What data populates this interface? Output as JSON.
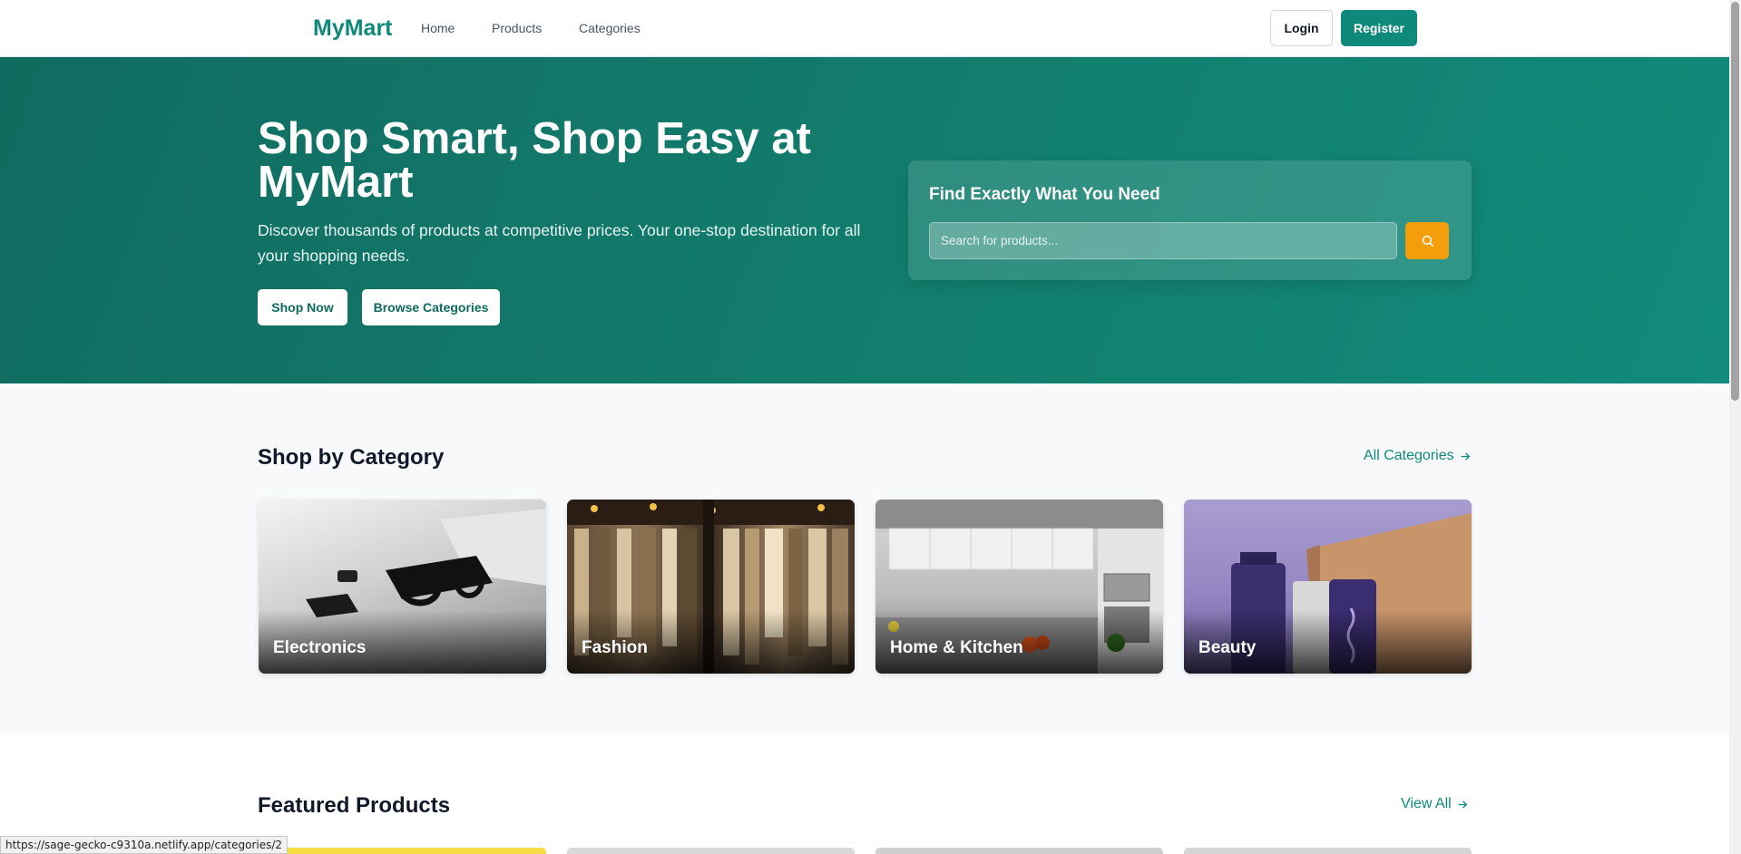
{
  "header": {
    "logo": "MyMart",
    "nav": [
      "Home",
      "Products",
      "Categories"
    ],
    "login": "Login",
    "register": "Register"
  },
  "hero": {
    "title": "Shop Smart, Shop Easy at MyMart",
    "subtitle": "Discover thousands of products at competitive prices. Your one-stop destination for all your shopping needs.",
    "shop_now": "Shop Now",
    "browse": "Browse Categories",
    "search": {
      "title": "Find Exactly What You Need",
      "placeholder": "Search for products..."
    }
  },
  "categories": {
    "title": "Shop by Category",
    "link": "All Categories",
    "items": [
      {
        "label": "Electronics"
      },
      {
        "label": "Fashion"
      },
      {
        "label": "Home & Kitchen"
      },
      {
        "label": "Beauty"
      }
    ]
  },
  "featured": {
    "title": "Featured Products",
    "link": "View All"
  },
  "status_bar": {
    "url": "https://sage-gecko-c9310a.netlify.app/categories/2"
  },
  "colors": {
    "brand": "#0f8a7a",
    "accent": "#f59e0b"
  },
  "icons": [
    "search-icon",
    "arrow-right-icon"
  ]
}
